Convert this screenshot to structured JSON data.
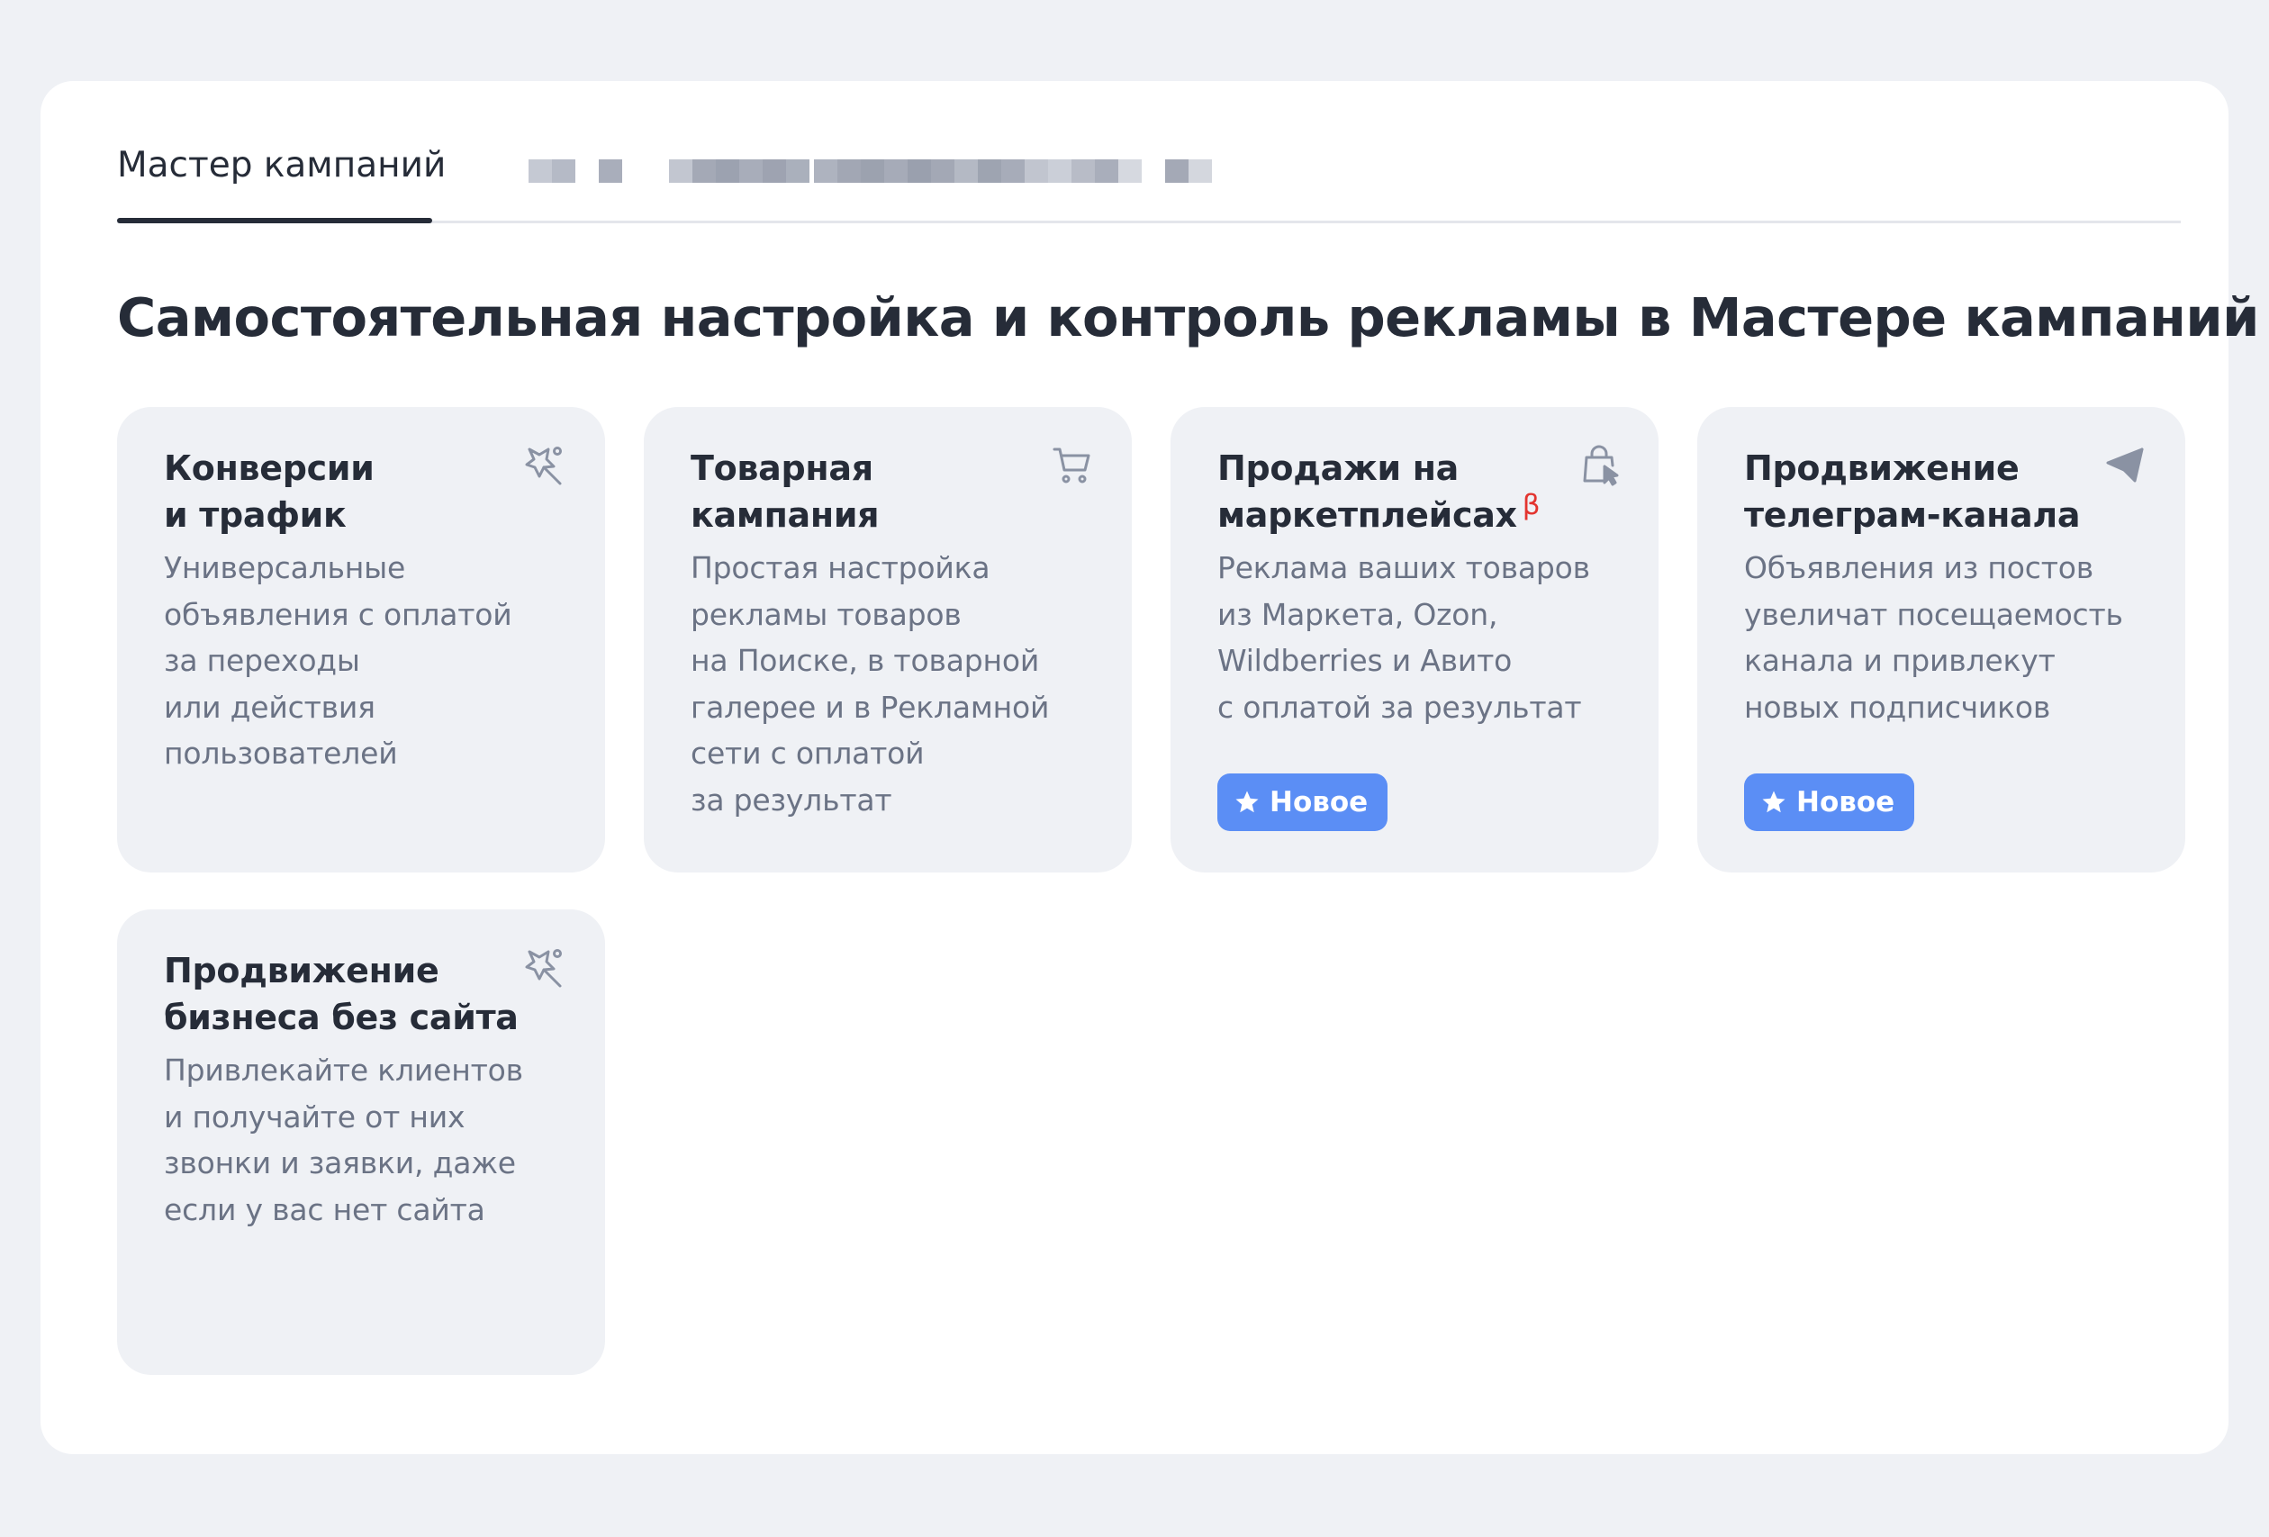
{
  "tabs": {
    "active_label": "Мастер кампаний"
  },
  "heading": "Самостоятельная настройка и контроль рекламы в Мастере кампаний",
  "cards": [
    {
      "title": "Конверсии\nи трафик",
      "description": "Универсальные\nобъявления с оплатой\nза переходы\nили действия\nпользователей",
      "icon": "magic-wand-icon"
    },
    {
      "title": "Товарная\nкампания",
      "description": "Простая настройка\nрекламы товаров\nна Поиске, в товарной\nгалерее и в Рекламной\nсети с оплатой\nза результат",
      "icon": "shopping-cart-icon"
    },
    {
      "title": "Продажи на\nмаркетплейсах",
      "beta": "β",
      "description": "Реклама ваших товаров\nиз Маркета, Ozon,\nWildberries и Авито\nс оплатой за результат",
      "badge": "Новое",
      "icon": "shopping-bag-cursor-icon"
    },
    {
      "title": "Продвижение\nтелеграм-канала",
      "description": "Объявления из постов\nувеличат посещаемость\nканала и привлекут\nновых подписчиков",
      "badge": "Новое",
      "icon": "paper-plane-icon"
    },
    {
      "title": "Продвижение\nбизнеса без сайта",
      "description": "Привлекайте клиентов\nи получайте от них\nзвонки и заявки, даже\nесли у вас нет сайта",
      "icon": "magic-wand-icon"
    }
  ],
  "colors": {
    "page_background": "#eff1f5",
    "panel": "#ffffff",
    "card": "#eff1f5",
    "text_primary": "#262c38",
    "text_secondary": "#6b7385",
    "badge": "#5b8ef5",
    "beta": "#e3342f",
    "icon": "#8a92a3"
  }
}
